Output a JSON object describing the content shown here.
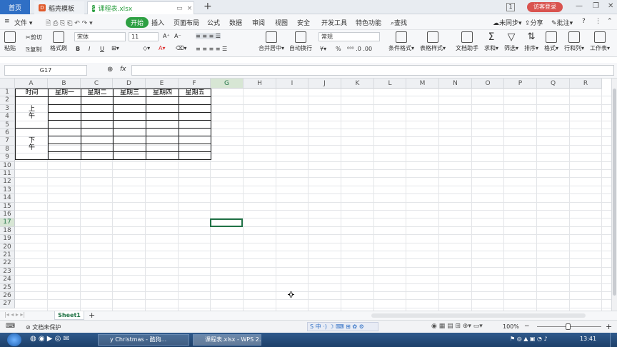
{
  "tabs": {
    "home": "首页",
    "template": "稻壳模板",
    "file": "课程表.xlsx",
    "add": "+"
  },
  "window": {
    "num": "1",
    "login": "访客登录",
    "min": "—",
    "restore": "❐",
    "close": "✕"
  },
  "menu": {
    "file": "文件",
    "items": [
      "开始",
      "插入",
      "页面布局",
      "公式",
      "数据",
      "审阅",
      "视图",
      "安全",
      "开发工具",
      "特色功能"
    ],
    "search": "查找",
    "sync": "未同步",
    "share": "分享",
    "comment": "批注",
    "help": "?"
  },
  "ribbon": {
    "paste": "粘贴",
    "cut": "剪切",
    "copy": "复制",
    "format_painter": "格式刷",
    "font": "宋体",
    "size": "11",
    "number_format": "常规",
    "merge": "合并居中",
    "wrap": "自动换行",
    "cond": "条件格式",
    "table_style": "表格样式",
    "doc_helper": "文档助手",
    "sum": "求和",
    "filter": "筛选",
    "sort": "排序",
    "format": "格式",
    "rowcol": "行和列",
    "sheet": "工作表",
    "bold": "B",
    "italic": "I",
    "underline": "U",
    "grow": "A⁺",
    "shrink": "A⁻",
    "percent": "%"
  },
  "formula": {
    "cell": "G17",
    "fx": "fx"
  },
  "columns": [
    "A",
    "B",
    "C",
    "D",
    "E",
    "F",
    "G",
    "H",
    "I",
    "J",
    "K",
    "L",
    "M",
    "N",
    "O",
    "P",
    "Q",
    "R"
  ],
  "rows": [
    "1",
    "2",
    "3",
    "4",
    "5",
    "6",
    "7",
    "8",
    "9",
    "10",
    "11",
    "12",
    "13",
    "14",
    "15",
    "16",
    "17",
    "18",
    "19",
    "20",
    "21",
    "22",
    "23",
    "24",
    "25",
    "26",
    "27"
  ],
  "table": {
    "header": [
      "时间",
      "星期一",
      "星期二",
      "星期三",
      "星期四",
      "星期五"
    ],
    "morning": "上\n午",
    "afternoon": "下\n午"
  },
  "sheet": {
    "name": "Sheet1",
    "add": "+"
  },
  "status": {
    "protect": "文档未保护",
    "zoom": "100%"
  },
  "taskbar": {
    "item1": "y Christmas - 酷狗...",
    "item2": "课程表.xlsx - WPS 2...",
    "time": "13:41"
  },
  "colors": {
    "accent": "#2f6fc5",
    "green": "#217346",
    "start": "#2ea043",
    "login": "#d9534f"
  }
}
